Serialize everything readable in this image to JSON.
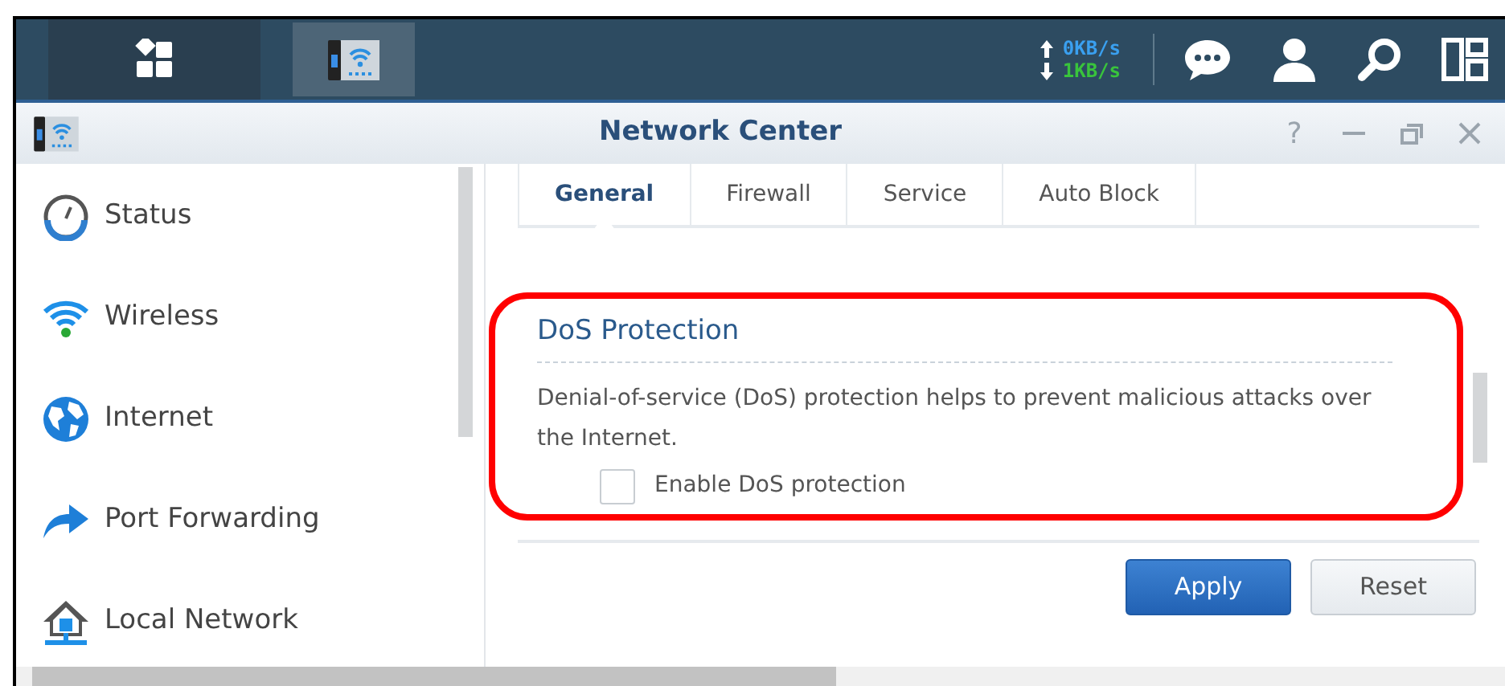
{
  "taskbar": {
    "upload_rate": "0KB/s",
    "download_rate": "1KB/s"
  },
  "window": {
    "title": "Network Center",
    "help": "?"
  },
  "sidebar": {
    "items": [
      {
        "label": "Status",
        "kind": "gauge"
      },
      {
        "label": "Wireless",
        "kind": "wifi"
      },
      {
        "label": "Internet",
        "kind": "globe"
      },
      {
        "label": "Port Forwarding",
        "kind": "arrow"
      },
      {
        "label": "Local Network",
        "kind": "house"
      }
    ]
  },
  "tabs": [
    {
      "label": "General",
      "selected": true
    },
    {
      "label": "Firewall",
      "selected": false
    },
    {
      "label": "Service",
      "selected": false
    },
    {
      "label": "Auto Block",
      "selected": false
    }
  ],
  "section": {
    "title": "DoS Protection",
    "description": "Denial-of-service (DoS) protection helps to prevent malicious attacks over the Internet.",
    "checkbox": {
      "label": "Enable DoS protection",
      "checked": false
    }
  },
  "buttons": [
    {
      "label": "Apply",
      "kind": "primary"
    },
    {
      "label": "Reset",
      "kind": "secondary"
    }
  ]
}
